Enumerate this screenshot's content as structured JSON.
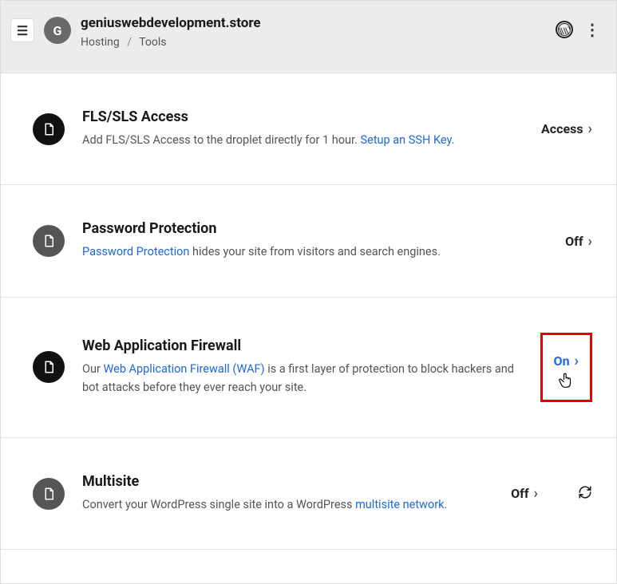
{
  "header": {
    "menu_icon_label": "menu",
    "avatar_letter": "G",
    "site_title": "geniuswebdevelopment.store",
    "breadcrumb": {
      "root": "Hosting",
      "sep": "/",
      "current": "Tools"
    }
  },
  "sections": [
    {
      "title": "FLS/SLS Access",
      "desc_pre": "Add FLS/SLS Access to the droplet directly for 1 hour. ",
      "link": "Setup an SSH Key",
      "desc_post": ".",
      "action": "Access",
      "icon_style": "black"
    },
    {
      "title": "Password Protection",
      "link": "Password Protection",
      "desc_post": " hides your site from visitors and search engines.",
      "action": "Off",
      "icon_style": "grey"
    },
    {
      "title": "Web Application Firewall",
      "desc_pre": "Our ",
      "link": "Web Application Firewall (WAF)",
      "desc_post": " is a first layer of protection to block hackers and bot attacks before they ever reach your site.",
      "action": "On",
      "icon_style": "black",
      "highlighted": true
    },
    {
      "title": "Multisite",
      "desc_pre": "Convert your WordPress single site into a WordPress ",
      "link": "multisite network",
      "desc_post": ".",
      "action": "Off",
      "icon_style": "grey",
      "refresh": true
    }
  ]
}
